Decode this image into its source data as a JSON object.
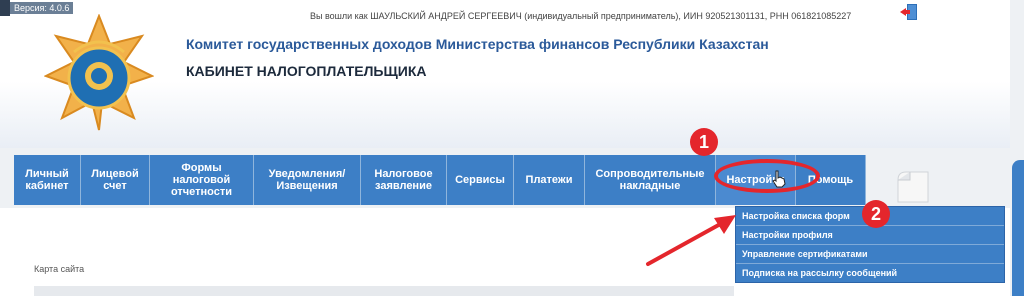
{
  "header": {
    "version": "Версия: 4.0.6",
    "user_info": "Вы вошли как ШАУЛЬСКИЙ АНДРЕЙ СЕРГЕЕВИЧ (индивидуальный предприниматель), ИИН 920521301131, РНН 061821085227",
    "org_title": "Комитет государственных доходов Министерства финансов Республики Казахстан",
    "cabinet_title": "КАБИНЕТ НАЛОГОПЛАТЕЛЬЩИКА",
    "emblem_icon": "kgd-emblem-icon",
    "exit_icon": "exit-door-icon"
  },
  "nav": {
    "items": [
      {
        "label": "Личный\nкабинет"
      },
      {
        "label": "Лицевой\nсчет"
      },
      {
        "label": "Формы\nналоговой\nотчетности"
      },
      {
        "label": "Уведомления/\nИзвещения"
      },
      {
        "label": "Налоговое\nзаявление"
      },
      {
        "label": "Сервисы"
      },
      {
        "label": "Платежи"
      },
      {
        "label": "Сопроводительные\nнакладные"
      },
      {
        "label": "Настройки"
      },
      {
        "label": "Помощь"
      }
    ]
  },
  "dropdown": {
    "items": [
      {
        "label": "Настройка списка форм"
      },
      {
        "label": "Настройки профиля"
      },
      {
        "label": "Управление сертификатами"
      },
      {
        "label": "Подписка на рассылку сообщений"
      }
    ]
  },
  "content": {
    "sitemap_label": "Карта сайта"
  },
  "annotations": {
    "badge1": "1",
    "badge2": "2",
    "color": "#e4262c"
  },
  "colors": {
    "nav_bg": "#3d7fc6",
    "title_blue": "#2b5a9a"
  }
}
